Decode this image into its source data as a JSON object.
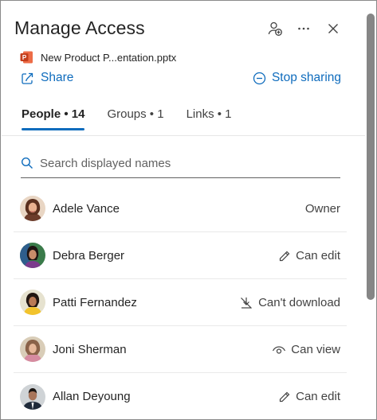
{
  "dialog": {
    "title": "Manage Access"
  },
  "header_icons": {
    "add_person": "person-add-icon",
    "more": "more-icon",
    "close": "close-icon"
  },
  "file": {
    "icon": "powerpoint-icon",
    "name": "New Product P...entation.pptx"
  },
  "actions": {
    "share_label": "Share",
    "share_icon": "share-icon",
    "stop_label": "Stop sharing",
    "stop_icon": "stop-circle-icon"
  },
  "tabs": [
    {
      "label": "People • 14",
      "active": true
    },
    {
      "label": "Groups • 1",
      "active": false
    },
    {
      "label": "Links • 1",
      "active": false
    }
  ],
  "search": {
    "placeholder": "Search displayed names",
    "value": ""
  },
  "people": [
    {
      "name": "Adele Vance",
      "permission": "Owner",
      "permission_icon": ""
    },
    {
      "name": "Debra Berger",
      "permission": "Can edit",
      "permission_icon": "pencil-icon"
    },
    {
      "name": "Patti Fernandez",
      "permission": "Can't download",
      "permission_icon": "no-download-icon"
    },
    {
      "name": "Joni Sherman",
      "permission": "Can view",
      "permission_icon": "eye-icon"
    },
    {
      "name": "Allan Deyoung",
      "permission": "Can edit",
      "permission_icon": "pencil-icon"
    }
  ],
  "colors": {
    "accent": "#0f6cbd",
    "powerpoint": "#c43e1c",
    "text": "#242424"
  }
}
